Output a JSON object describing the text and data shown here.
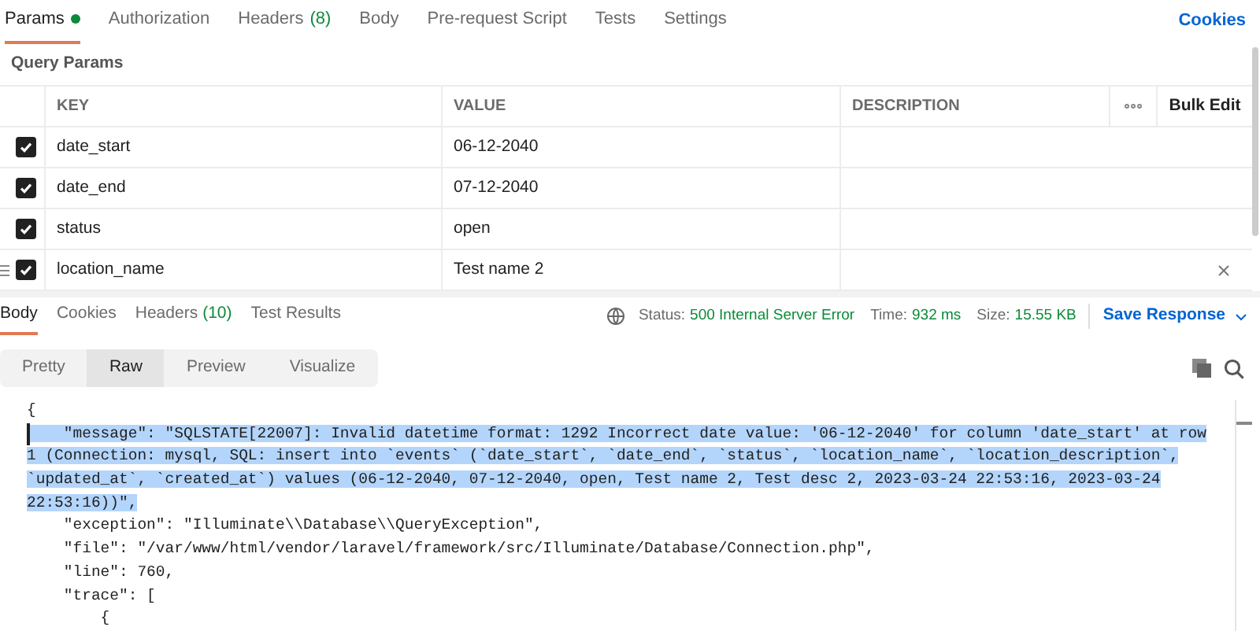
{
  "request_tabs": [
    {
      "label": "Params",
      "selected": true,
      "dot": true
    },
    {
      "label": "Authorization",
      "selected": false
    },
    {
      "label": "Headers",
      "count": "(8)",
      "selected": false
    },
    {
      "label": "Body",
      "selected": false
    },
    {
      "label": "Pre-request Script",
      "selected": false
    },
    {
      "label": "Tests",
      "selected": false
    },
    {
      "label": "Settings",
      "selected": false
    }
  ],
  "cookies_link": "Cookies",
  "section_title": "Query Params",
  "params_table": {
    "columns": [
      "KEY",
      "VALUE",
      "DESCRIPTION"
    ],
    "bulk_edit": "Bulk Edit",
    "rows": [
      {
        "checked": true,
        "key": "date_start",
        "value": "06-12-2040"
      },
      {
        "checked": true,
        "key": "date_end",
        "value": "07-12-2040"
      },
      {
        "checked": true,
        "key": "status",
        "value": "open"
      },
      {
        "checked": true,
        "key": "location_name",
        "value": "Test name 2",
        "hovered": true
      }
    ]
  },
  "response_tabs": [
    {
      "label": "Body",
      "selected": true
    },
    {
      "label": "Cookies",
      "selected": false
    },
    {
      "label": "Headers",
      "count": "(10)",
      "selected": false
    },
    {
      "label": "Test Results",
      "selected": false
    }
  ],
  "status": [
    {
      "label": "Status:",
      "value": "500 Internal Server Error"
    },
    {
      "label": "Time:",
      "value": "932 ms"
    },
    {
      "label": "Size:",
      "value": "15.55 KB"
    }
  ],
  "save_response": "Save Response",
  "view_modes": [
    {
      "label": "Pretty",
      "selected": false
    },
    {
      "label": "Raw",
      "selected": true
    },
    {
      "label": "Preview",
      "selected": false
    },
    {
      "label": "Visualize",
      "selected": false
    }
  ],
  "code_lines": [
    {
      "text": "{",
      "selected": false
    },
    {
      "text": "    \"message\": \"SQLSTATE[22007]: Invalid datetime format: 1292 Incorrect date value: '06-12-2040' for column 'date_start' at row",
      "selected": true
    },
    {
      "text": "1 (Connection: mysql, SQL: insert into `events` (`date_start`, `date_end`, `status`, `location_name`, `location_description`,",
      "selected": true
    },
    {
      "text": "`updated_at`, `created_at`) values (06-12-2040, 07-12-2040, open, Test name 2, Test desc 2, 2023-03-24 22:53:16, 2023-03-24",
      "selected": true
    },
    {
      "text": "22:53:16))\",",
      "selected": true
    },
    {
      "text": "    \"exception\": \"Illuminate\\\\Database\\\\QueryException\",",
      "selected": false
    },
    {
      "text": "    \"file\": \"/var/www/html/vendor/laravel/framework/src/Illuminate/Database/Connection.php\",",
      "selected": false
    },
    {
      "text": "    \"line\": 760,",
      "selected": false
    },
    {
      "text": "    \"trace\": [",
      "selected": false
    },
    {
      "text": "        {",
      "selected": false
    }
  ]
}
